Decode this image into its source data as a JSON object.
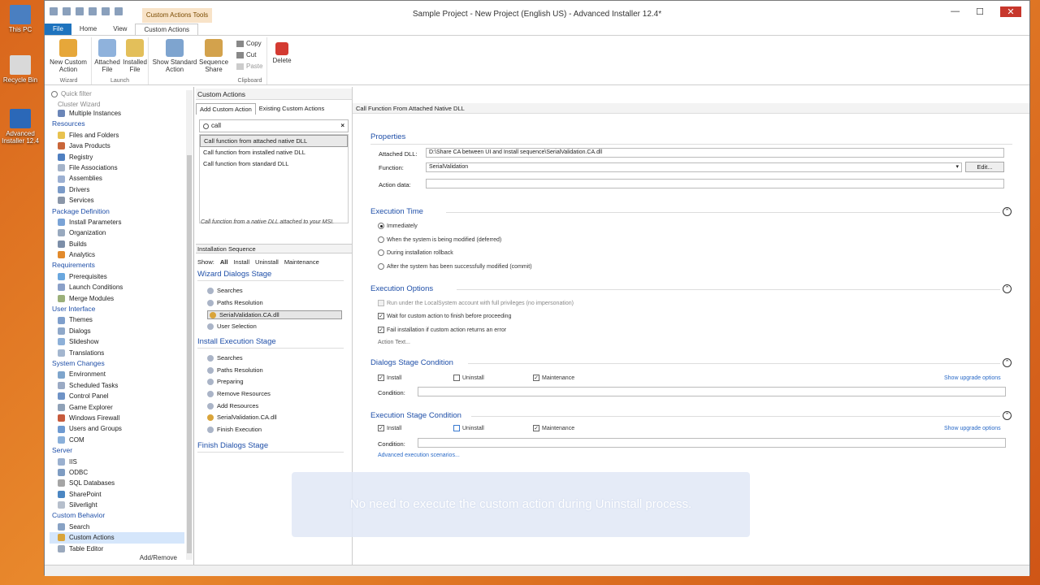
{
  "desktop": {
    "icons": [
      "This PC",
      "Recycle Bin",
      "Advanced Installer 12.4"
    ]
  },
  "window": {
    "context_tab": "Custom Actions Tools",
    "title": "Sample Project - New Project (English US) - Advanced Installer 12.4*",
    "minimize": "—",
    "maximize": "☐",
    "close": "✕"
  },
  "ribbon": {
    "tabs": [
      "File",
      "Home",
      "View",
      "Custom Actions"
    ],
    "buttons": {
      "new_custom_action": "New Custom Action",
      "attached_file": "Attached File",
      "installed_file": "Installed File",
      "show_standard_action": "Show Standard Action",
      "sequence_share": "Sequence Share",
      "copy": "Copy",
      "cut": "Cut",
      "paste": "Paste",
      "delete": "Delete"
    },
    "groups": {
      "wizard": "Wizard",
      "launch": "Launch",
      "clipboard": "Clipboard"
    }
  },
  "left": {
    "filter_placeholder": "Quick filter",
    "cut_item": "Cluster Wizard",
    "multiple_instances": "Multiple Instances",
    "tree": [
      {
        "cat": "Resources",
        "items": [
          "Files and Folders",
          "Java Products",
          "Registry",
          "File Associations",
          "Assemblies",
          "Drivers",
          "Services"
        ]
      },
      {
        "cat": "Package Definition",
        "items": [
          "Install Parameters",
          "Organization",
          "Builds",
          "Analytics"
        ]
      },
      {
        "cat": "Requirements",
        "items": [
          "Prerequisites",
          "Launch Conditions",
          "Merge Modules"
        ]
      },
      {
        "cat": "User Interface",
        "items": [
          "Themes",
          "Dialogs",
          "Slideshow",
          "Translations"
        ]
      },
      {
        "cat": "System Changes",
        "items": [
          "Environment",
          "Scheduled Tasks",
          "Control Panel",
          "Game Explorer",
          "Windows Firewall",
          "Users and Groups",
          "COM"
        ]
      },
      {
        "cat": "Server",
        "items": [
          "IIS",
          "ODBC",
          "SQL Databases",
          "SharePoint",
          "Silverlight"
        ]
      },
      {
        "cat": "Custom Behavior",
        "items": [
          "Search",
          "Custom Actions",
          "Table Editor"
        ]
      }
    ],
    "add_remove": "Add/Remove"
  },
  "center": {
    "header": "Custom Actions",
    "tabs": [
      "Add Custom Action",
      "Existing Custom Actions"
    ],
    "search_value": "call",
    "results": [
      "Call function from attached native DLL",
      "Call function from installed native DLL",
      "Call function from standard DLL"
    ],
    "description": "Call function from a native DLL attached to your MSI.",
    "installation_sequence": "Installation Sequence",
    "show_label": "Show:",
    "show_options": [
      "All",
      "Install",
      "Uninstall",
      "Maintenance"
    ],
    "stages": {
      "wizard": {
        "title": "Wizard Dialogs Stage",
        "items": [
          "Searches",
          "Paths Resolution",
          "SerialValidation.CA.dll",
          "User Selection"
        ]
      },
      "install": {
        "title": "Install Execution Stage",
        "items": [
          "Searches",
          "Paths Resolution",
          "Preparing",
          "Remove Resources",
          "Add Resources",
          "SerialValidation.CA.dll",
          "Finish Execution"
        ]
      },
      "finish": {
        "title": "Finish Dialogs Stage"
      }
    }
  },
  "right": {
    "header": "Call Function From Attached Native DLL",
    "properties": {
      "title": "Properties",
      "attached_dll_label": "Attached DLL:",
      "attached_dll_value": "D:\\Share CA between UI and Install sequence\\SerialValidation.CA.dll",
      "function_label": "Function:",
      "function_value": "SerialValidation",
      "edit_button": "Edit...",
      "action_data_label": "Action data:",
      "action_data_value": ""
    },
    "execution_time": {
      "title": "Execution Time",
      "options": [
        "Immediately",
        "When the system is being modified (deferred)",
        "During installation rollback",
        "After the system has been successfully modified (commit)"
      ]
    },
    "execution_options": {
      "title": "Execution Options",
      "opt1": "Run under the LocalSystem account with full privileges (no impersonation)",
      "opt2": "Wait for custom action to finish before proceeding",
      "opt3": "Fail installation if custom action returns an error",
      "action_text": "Action Text..."
    },
    "dialogs_condition": {
      "title": "Dialogs Stage Condition",
      "install": "Install",
      "uninstall": "Uninstall",
      "maintenance": "Maintenance",
      "upgrade": "Show upgrade options",
      "condition_label": "Condition:",
      "condition_value": ""
    },
    "execution_condition": {
      "title": "Execution Stage Condition",
      "install": "Install",
      "uninstall": "Uninstall",
      "maintenance": "Maintenance",
      "upgrade": "Show upgrade options",
      "condition_label": "Condition:",
      "condition_value": "",
      "advanced": "Advanced execution scenarios..."
    }
  },
  "caption": "No need to execute the custom action during Uninstall process."
}
